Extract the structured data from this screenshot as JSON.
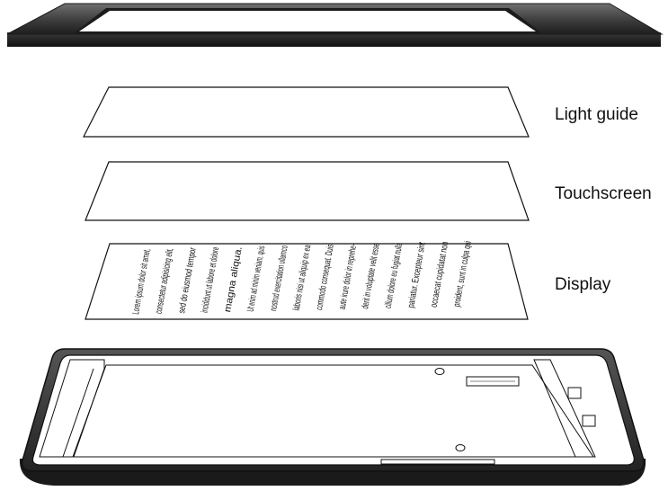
{
  "labels": {
    "light_guide": "Light guide",
    "touchscreen": "Touchscreen",
    "display": "Display"
  },
  "display_text_lines": [
    "Lorem ipsum dolor sit amet,",
    "consectetur adipisicing elit,",
    "sed do eiusmod tempor",
    "incididunt ut labore et dolore",
    "magna aliqua.",
    "Ut enim ad minim veniam, quis",
    "nostrud exercitation ullamco",
    "laboris nisi ut aliquip ex ea",
    "commodo consequat. Duis",
    "aute irure dolor in reprehe-",
    "derit in voluptate velit esse",
    "cillum dolore eu fugiat nulla",
    "pariatur. Excepteur sint",
    "occaecat cupidatat non",
    "proident, sunt in culpa qui"
  ],
  "colors": {
    "bezel_top": "#6a6a6a",
    "bezel_mid": "#3a3a3a",
    "bezel_dark": "#1a1a1a",
    "outline": "#111111",
    "panel": "#ffffff"
  }
}
